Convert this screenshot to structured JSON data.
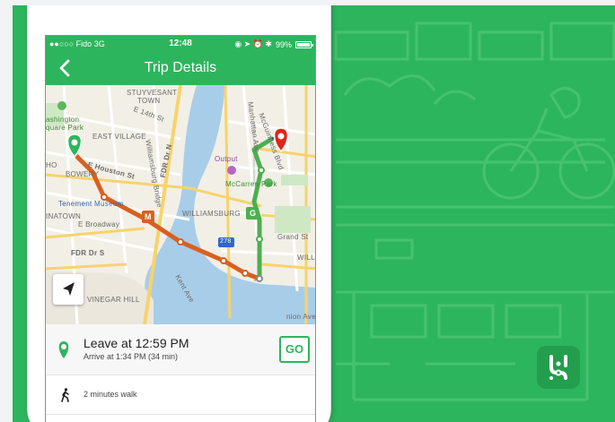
{
  "colors": {
    "brand_green": "#2db55d",
    "subway_orange": "#d9601f",
    "line_green": "#4caf50",
    "destination_red": "#e2231a"
  },
  "status_bar": {
    "carrier": "●●○○○ Fido  3G",
    "time": "12:48",
    "battery": "99%"
  },
  "nav": {
    "back_icon": "chevron-left-icon",
    "title": "Trip Details"
  },
  "map": {
    "labels": {
      "stuyvesant": "STUYVESANT",
      "town": "TOWN",
      "e14": "E 14th St",
      "washington1": "ashington",
      "washington2": "quare Park",
      "east_village": "EAST VILLAGE",
      "fdr_dr_n": "FDR Dr N",
      "williamsburg_bridge": "Williamsburg Bridge",
      "e_houston": "E Houston St",
      "bowery": "BOWERY",
      "ho": "HO",
      "tenement": "Tenement Museum",
      "chinatown": "INATOWN",
      "broadway": "E Broadway",
      "fdr_dr_s": "FDR Dr S",
      "vinegar_hill": "VINEGAR HILL",
      "williamsburg": "WILLIAMSBURG",
      "output": "Output",
      "mccarren": "McCarren Park",
      "mcguinness1": "McGuinness Blvd",
      "manhattan_ave": "Manhattan Ave",
      "grand_st": "Grand St",
      "kent_ave": "Kent Ave",
      "will": "WILL",
      "union_ave": "nion Ave",
      "hwy_278": "278",
      "subway_m": "M",
      "subway_g": "G",
      "seventh_ave": "Ave"
    },
    "locate_icon": "navigation-arrow-icon"
  },
  "trip": {
    "leave_text": "Leave at 12:59 PM",
    "arrive_text": "Arrive at 1:34 PM (34 min)",
    "go_label": "GO",
    "walk_text": "2 minutes walk"
  },
  "branding": {
    "logo_icon": "transit-app-logo-icon"
  }
}
